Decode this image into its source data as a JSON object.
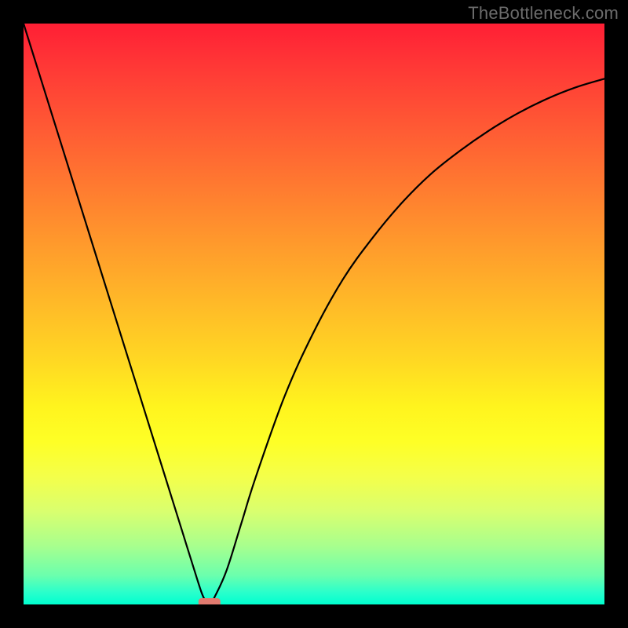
{
  "watermark": "TheBottleneck.com",
  "chart_data": {
    "type": "line",
    "title": "",
    "xlabel": "",
    "ylabel": "",
    "xlim": [
      0,
      100
    ],
    "ylim": [
      0,
      100
    ],
    "series": [
      {
        "name": "bottleneck-curve",
        "x": [
          0,
          5,
          10,
          15,
          20,
          25,
          27.5,
          30,
          31,
          32,
          33,
          35,
          37.5,
          40,
          45,
          50,
          55,
          60,
          65,
          70,
          75,
          80,
          85,
          90,
          95,
          100
        ],
        "y": [
          100,
          84,
          68,
          52,
          36,
          20,
          12,
          4,
          1.2,
          0,
          1.5,
          6,
          14,
          22,
          36,
          47,
          56,
          63,
          69,
          74,
          78,
          81.5,
          84.5,
          87,
          89,
          90.5
        ]
      }
    ],
    "optimal_marker": {
      "x": 32,
      "y": 0
    },
    "background_gradient": {
      "orientation": "vertical",
      "stops": [
        {
          "pos": 0.0,
          "color": "#ff1f35"
        },
        {
          "pos": 0.5,
          "color": "#ffb928"
        },
        {
          "pos": 0.7,
          "color": "#feff26"
        },
        {
          "pos": 1.0,
          "color": "#00ffcf"
        }
      ]
    }
  }
}
